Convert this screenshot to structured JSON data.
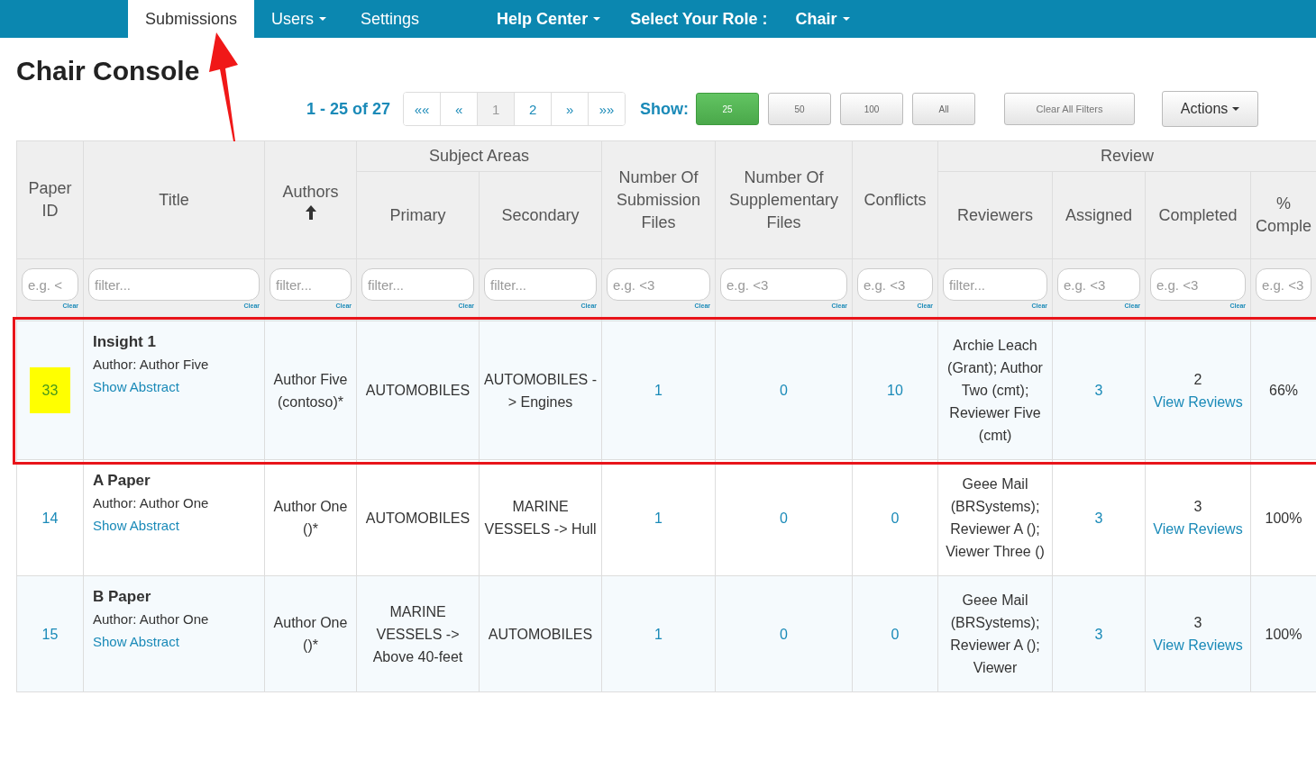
{
  "nav": {
    "items": [
      {
        "label": "Submissions",
        "dropdown": false,
        "selected": true
      },
      {
        "label": "Users",
        "dropdown": true,
        "selected": false
      },
      {
        "label": "Settings",
        "dropdown": false,
        "selected": false
      },
      {
        "label": "Help Center",
        "dropdown": true,
        "selected": false
      }
    ],
    "role_label": "Select Your Role :",
    "role": "Chair"
  },
  "title": "Chair Console",
  "pager": {
    "summary": "1 - 25 of 27",
    "pages": [
      {
        "label": "««",
        "selected": false
      },
      {
        "label": "«",
        "selected": false
      },
      {
        "label": "1",
        "selected": true
      },
      {
        "label": "2",
        "selected": false
      },
      {
        "label": "»",
        "selected": false
      },
      {
        "label": "»»",
        "selected": false
      }
    ]
  },
  "show": {
    "label": "Show:",
    "options": [
      {
        "label": "25",
        "selected": true
      },
      {
        "label": "50",
        "selected": false
      },
      {
        "label": "100",
        "selected": false
      },
      {
        "label": "All",
        "selected": false
      }
    ]
  },
  "clear_button": "Clear All Filters",
  "actions_button": "Actions",
  "table": {
    "headers": [
      {
        "label": "Paper ID",
        "sorted": false
      },
      {
        "label": "Title",
        "sorted": false
      },
      {
        "label": "Authors",
        "sorted": true
      },
      {
        "group": "Subject Areas",
        "children": [
          {
            "label": "Primary"
          },
          {
            "label": "Secondary"
          }
        ]
      },
      {
        "label": "Number Of Submission Files",
        "sorted": false
      },
      {
        "label": "Number Of Supplementary Files",
        "sorted": false
      },
      {
        "label": "Conflicts",
        "sorted": false
      },
      {
        "group": "Review",
        "children": [
          {
            "label": "Reviewers"
          },
          {
            "label": "Assigned"
          },
          {
            "label": "Completed"
          },
          {
            "label": "% Comple"
          }
        ]
      }
    ],
    "filters": [
      {
        "placeholder": "e.g. <",
        "clear": "Clear"
      },
      {
        "placeholder": "filter...",
        "clear": "Clear"
      },
      {
        "placeholder": "filter...",
        "clear": "Clear"
      },
      {
        "placeholder": "filter...",
        "clear": "Clear"
      },
      {
        "placeholder": "filter...",
        "clear": "Clear"
      },
      {
        "placeholder": "e.g. <3",
        "clear": "Clear"
      },
      {
        "placeholder": "e.g. <3",
        "clear": "Clear"
      },
      {
        "placeholder": "e.g. <3",
        "clear": "Clear"
      },
      {
        "placeholder": "filter...",
        "clear": "Clear"
      },
      {
        "placeholder": "e.g. <3",
        "clear": "Clear"
      },
      {
        "placeholder": "e.g. <3",
        "clear": "Clear"
      },
      {
        "placeholder": "e.g. <3"
      }
    ],
    "rows": [
      {
        "highlighted": true,
        "id_marked": true,
        "paper_id": "33",
        "title": "Insight 1",
        "author_line": "Author: Author Five",
        "abstract_link": "Show Abstract",
        "authors": "Author Five (contoso)*",
        "primary": "AUTOMOBILES",
        "secondary": "AUTOMOBILES -> Engines",
        "submission_files": "1",
        "supplementary_files": "0",
        "conflicts": "10",
        "reviewers": "Archie Leach (Grant); Author Two (cmt); Reviewer Five (cmt)",
        "assigned": "3",
        "completed": "2",
        "reviews_link": "View Reviews",
        "percent": "66%"
      },
      {
        "highlighted": false,
        "id_marked": false,
        "paper_id": "14",
        "title": "A Paper",
        "author_line": "Author: Author One",
        "abstract_link": "Show Abstract",
        "authors": "Author One ()*",
        "primary": "AUTOMOBILES",
        "secondary": "MARINE VESSELS -> Hull",
        "submission_files": "1",
        "supplementary_files": "0",
        "conflicts": "0",
        "reviewers": "Geee Mail (BRSystems); Reviewer A (); Viewer Three ()",
        "assigned": "3",
        "completed": "3",
        "reviews_link": "View Reviews",
        "percent": "100%"
      },
      {
        "highlighted": false,
        "id_marked": false,
        "paper_id": "15",
        "title": "B Paper",
        "author_line": "Author: Author One",
        "abstract_link": "Show Abstract",
        "authors": "Author One ()*",
        "primary": "MARINE VESSELS -> Above 40-feet",
        "secondary": "AUTOMOBILES",
        "submission_files": "1",
        "supplementary_files": "0",
        "conflicts": "0",
        "reviewers": "Geee Mail (BRSystems); Reviewer A (); Viewer",
        "assigned": "3",
        "completed": "3",
        "reviews_link": "View Reviews",
        "percent": "100%"
      }
    ]
  }
}
